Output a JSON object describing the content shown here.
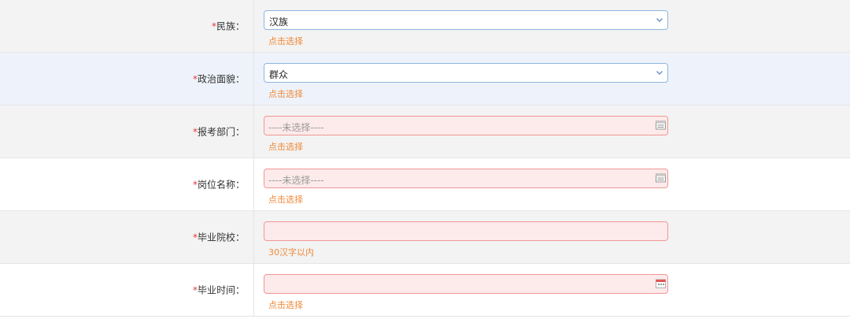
{
  "required_mark": "*",
  "colon": "：",
  "rows": [
    {
      "label": "民族",
      "value": "汉族",
      "hint": "点击选择"
    },
    {
      "label": "政治面貌",
      "value": "群众",
      "hint": "点击选择"
    },
    {
      "label": "报考部门",
      "placeholder": "----未选择----",
      "hint": "点击选择"
    },
    {
      "label": "岗位名称",
      "placeholder": "----未选择----",
      "hint": "点击选择"
    },
    {
      "label": "毕业院校",
      "value": "",
      "hint": "30汉字以内"
    },
    {
      "label": "毕业时间",
      "value": "",
      "hint": "点击选择"
    }
  ],
  "colors": {
    "required": "#e4393c",
    "hint": "#f08a3a",
    "invalid_bg": "#fdeaea",
    "invalid_border": "#f19797",
    "select_border": "#8fb4e0"
  },
  "icons": {
    "dropdown": "chevron-down-icon",
    "picker": "calendar-picker-icon"
  }
}
